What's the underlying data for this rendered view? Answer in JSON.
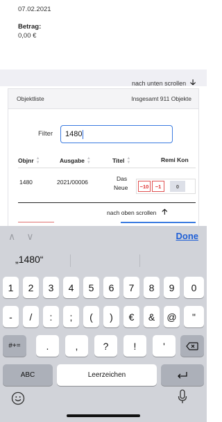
{
  "detail": {
    "date": "07.02.2021",
    "betrag_label": "Betrag:",
    "betrag_value": "0,00 €"
  },
  "scroll_down": "nach unten scrollen",
  "objektliste": {
    "title": "Objektliste",
    "total": "Insgesamt 911 Objekte",
    "filter_label": "Filter",
    "filter_value": "1480",
    "columns": [
      "Objnr",
      "Ausgabe",
      "Titel",
      "Remi Kon"
    ],
    "rows": [
      {
        "objnr": "1480",
        "ausgabe": "2021/00006",
        "titel_line1": "Das",
        "titel_line2": "Neue",
        "remi_minus10": "−10",
        "remi_minus1": "−1",
        "konto": "0"
      }
    ],
    "scroll_up": "nach oben scrollen"
  },
  "keyboard": {
    "done": "Done",
    "suggestion": "„1480“",
    "row1": [
      "1",
      "2",
      "3",
      "4",
      "5",
      "6",
      "7",
      "8",
      "9",
      "0"
    ],
    "row2": [
      "-",
      "/",
      ":",
      ";",
      "(",
      ")",
      "€",
      "&",
      "@",
      "\""
    ],
    "row3_left": "#+=",
    "row3": [
      ".",
      ",",
      "?",
      "!",
      "'"
    ],
    "abc": "ABC",
    "space": "Leerzeichen",
    "return_icon": "return-icon",
    "delete_icon": "delete-icon"
  }
}
